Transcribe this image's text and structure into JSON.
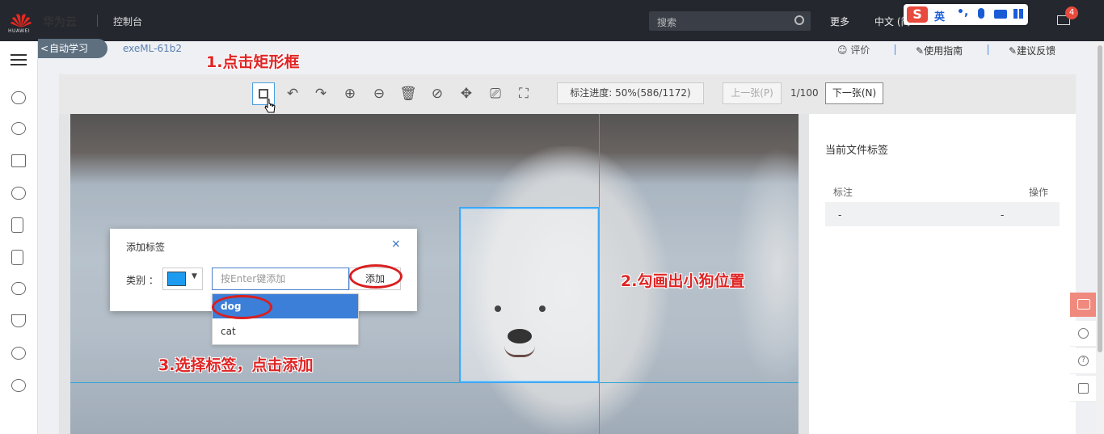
{
  "topbar": {
    "logo_text": "HUAWEI",
    "brand": "华为云",
    "console": "控制台",
    "search_placeholder": "搜索",
    "more": "更多",
    "lang": "中文 (简",
    "mail_badge": "4",
    "ime": {
      "logo": "S",
      "mode": "英",
      "punct": "•,"
    }
  },
  "subheader": {
    "back_label": "自动学习",
    "project": "exeML-61b2",
    "rate": "评价",
    "guide": "使用指南",
    "feedback": "建议反馈"
  },
  "toolbar": {
    "progress": "标注进度: 50%(586/1172)",
    "prev": "上一张(P)",
    "page": "1/100",
    "next": "下一张(N)"
  },
  "right_panel": {
    "title": "当前文件标签",
    "col_label": "标注",
    "col_action": "操作",
    "row_label": "-",
    "row_action": "-"
  },
  "dialog": {
    "title": "添加标签",
    "close": "×",
    "category_label": "类别 ：",
    "color": "#1d9bf0",
    "input_placeholder": "按Enter键添加",
    "add_button": "添加",
    "options": [
      "dog",
      "cat"
    ],
    "selected": "dog"
  },
  "annotations": {
    "step1": "1.点击矩形框",
    "step2": "2.勾画出小狗位置",
    "step3": "3.选择标签，点击添加"
  },
  "colors": {
    "accent": "#3b7fd9",
    "annotation": "#e02424",
    "topbar": "#24272e"
  }
}
